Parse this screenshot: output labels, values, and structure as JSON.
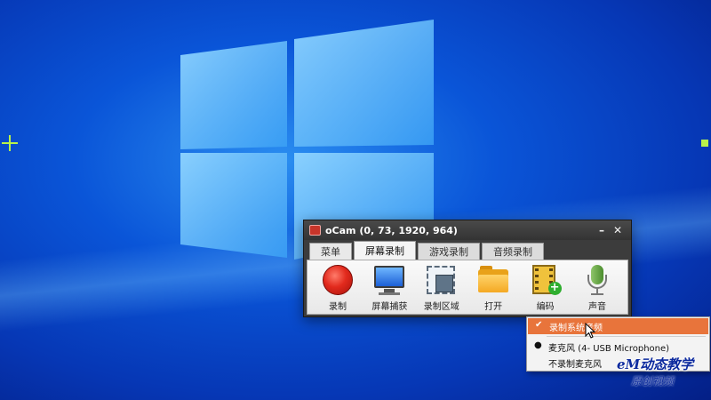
{
  "window": {
    "title": "oCam (0, 73, 1920, 964)",
    "minimize_glyph": "–",
    "close_glyph": "✕"
  },
  "tabs": [
    {
      "label": "菜单"
    },
    {
      "label": "屏幕录制"
    },
    {
      "label": "游戏录制"
    },
    {
      "label": "音频录制"
    }
  ],
  "toolbar": [
    {
      "label": "录制",
      "icon": "record-icon"
    },
    {
      "label": "屏幕捕获",
      "icon": "monitor-icon"
    },
    {
      "label": "录制区域",
      "icon": "region-icon"
    },
    {
      "label": "打开",
      "icon": "folder-icon"
    },
    {
      "label": "编码",
      "icon": "film-icon"
    },
    {
      "label": "声音",
      "icon": "microphone-icon"
    }
  ],
  "context_menu": {
    "items": [
      {
        "label": "录制系统音频",
        "mark": "✔",
        "highlighted": true
      },
      {
        "label": "麦克风 (4- USB Microphone)",
        "mark": "●"
      },
      {
        "label": "不录制麦克风",
        "mark": ""
      }
    ]
  },
  "watermark": {
    "line1": "eM动态教学",
    "line2": "原创视频"
  },
  "colors": {
    "highlight": "#e8743b",
    "desktop": "#0a55d8"
  }
}
